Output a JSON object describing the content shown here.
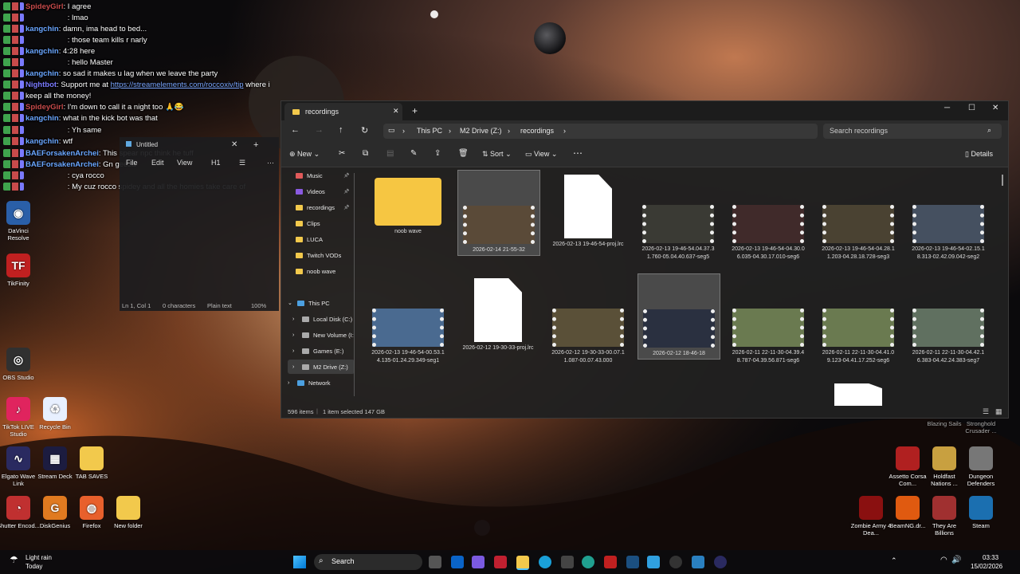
{
  "chat": [
    {
      "user": "SpideyGirl",
      "text": "I agree",
      "color": "#c84b4b"
    },
    {
      "user": "",
      "text": "lmao",
      "color": "#c84b4b"
    },
    {
      "user": "kangchin",
      "text": "damn, ima head to bed...",
      "color": "#6aa6ff"
    },
    {
      "user": "",
      "text": "those team kills r narly",
      "color": "#c84b4b"
    },
    {
      "user": "kangchin",
      "text": "4:28 here",
      "color": "#6aa6ff"
    },
    {
      "user": "",
      "text": "hello Master",
      "color": "#c84b4b"
    },
    {
      "user": "kangchin",
      "text": "so sad it makes u lag when we leave the party",
      "color": "#6aa6ff"
    },
    {
      "user": "Nightbot",
      "text": "Support me at",
      "link": "https://streamelements.com/roccoxiv/tip",
      "after": "where i",
      "color": "#7a7aff"
    },
    {
      "user": "",
      "text": "keep all the money!",
      "color": "#c84b4b"
    },
    {
      "user": "SpideyGirl",
      "text": "I'm down to call it a night too 🙏😂",
      "color": "#c84b4b"
    },
    {
      "user": "kangchin",
      "text": "what in the kick bot was that",
      "color": "#6aa6ff"
    },
    {
      "user": "",
      "text": "Yh same",
      "color": "#c84b4b"
    },
    {
      "user": "kangchin",
      "text": "wtf",
      "color": "#6aa6ff"
    },
    {
      "user": "BAEForsakenArchei",
      "text": "This spear npc think he tuff",
      "color": "#6aa6ff"
    },
    {
      "user": "BAEForsakenArchei",
      "text": "Gn geeza",
      "color": "#6aa6ff"
    },
    {
      "user": "",
      "text": "cya rocco",
      "color": "#c84b4b"
    },
    {
      "user": "",
      "text": "My cuz rocco spidey and all the homies take care of",
      "color": "#c84b4b"
    }
  ],
  "notepad": {
    "tab": "Untitled",
    "menu": [
      "File",
      "Edit",
      "View"
    ],
    "heading": "H1",
    "status": [
      "Ln 1, Col 1",
      "0 characters",
      "Plain text",
      "100%"
    ]
  },
  "desktop_left": [
    {
      "label": "DaVinci Resolve",
      "color": "#2a5fa8",
      "glyph": "◉"
    },
    {
      "label": "TikFinity",
      "color": "#c02020",
      "glyph": "TF"
    },
    {
      "label": "OBS Studio",
      "color": "#303030",
      "glyph": "◎"
    },
    {
      "label": "TikTok LIVE Studio",
      "color": "#e0245e",
      "glyph": "♪"
    },
    {
      "label": "Recycle Bin",
      "color": "#e8f0ff",
      "glyph": "♻"
    },
    {
      "label": "Elgato Wave Link",
      "color": "#2a2a60",
      "glyph": "∿"
    },
    {
      "label": "Stream Deck",
      "color": "#1c1c40",
      "glyph": "▦"
    },
    {
      "label": "TAB SAVES",
      "color": "#f2c94c",
      "glyph": ""
    },
    {
      "label": "Shutter Encod...",
      "color": "#c03030",
      "glyph": "◔"
    },
    {
      "label": "DiskGenius",
      "color": "#e07a20",
      "glyph": "G"
    },
    {
      "label": "Firefox",
      "color": "#e8602c",
      "glyph": "◍"
    },
    {
      "label": "New folder",
      "color": "#f2c94c",
      "glyph": ""
    }
  ],
  "desktop_right": [
    {
      "label": "Blazing Sails",
      "color": "#555"
    },
    {
      "label": "Stronghold Crusader ...",
      "color": "#555"
    },
    {
      "label": "Assetto Corsa Com...",
      "color": "#b02020"
    },
    {
      "label": "Holdfast Nations ...",
      "color": "#c8a040"
    },
    {
      "label": "Dungeon Defenders",
      "color": "#777"
    },
    {
      "label": "Zombie Army 4 Dea...",
      "color": "#8a1010"
    },
    {
      "label": "BeamNG.dr...",
      "color": "#e05a10"
    },
    {
      "label": "They Are Billions",
      "color": "#a03030"
    },
    {
      "label": "Steam",
      "color": "#1b6fb0"
    }
  ],
  "explorer": {
    "tab_title": "recordings",
    "breadcrumb": [
      "This PC",
      "M2 Drive (Z:)",
      "recordings"
    ],
    "search_placeholder": "Search recordings",
    "cmd": {
      "new": "New",
      "sort": "Sort",
      "view": "View",
      "details": "Details"
    },
    "quick_access": [
      "Music",
      "Videos",
      "recordings",
      "Clips",
      "LUCA",
      "Twitch VODs",
      "noob wave"
    ],
    "this_pc": "This PC",
    "drives": [
      "Local Disk (C:)",
      "New Volume (I:",
      "Games (E:)",
      "M2 Drive (Z:)"
    ],
    "network": "Network",
    "status": {
      "items": "596 items",
      "selected": "1 item selected  147 GB"
    },
    "files": [
      {
        "type": "folder",
        "name": "noob wave"
      },
      {
        "type": "video",
        "name": "2026-02-14 21-55-32",
        "selected": true,
        "tint": "#5a4a38"
      },
      {
        "type": "doc",
        "name": "2026-02-13 19-46-54-proj.lrc"
      },
      {
        "type": "video",
        "name": "2026-02-13 19-46-54.04.37.31.760-05.04.40.637-seg5",
        "tint": "#3a3a34"
      },
      {
        "type": "video",
        "name": "2026-02-13 19-46-54-04.30.06.035-04.30.17.010-seg6",
        "tint": "#402a2a"
      },
      {
        "type": "video",
        "name": "2026-02-13 19-46-54-04.28.11.203-04.28.18.728-seg3",
        "tint": "#4a4232"
      },
      {
        "type": "video",
        "name": "2026-02-13 19-46-54-02.15.18.313-02.42.09.042-seg2",
        "tint": "#455060"
      },
      {
        "type": "video",
        "name": "2026-02-13 19-46-54-00.53.14.135-01.24.29.349-seg1",
        "tint": "#4a6a90"
      },
      {
        "type": "doc",
        "name": "2026-02-12 19-30-33-proj.lrc"
      },
      {
        "type": "video",
        "name": "2026-02-12 19-30-33-00.07.11.087-00.07.43.000",
        "tint": "#5a5038"
      },
      {
        "type": "video",
        "name": "2026-02-12 18-46-18",
        "selected": true,
        "tint": "#2a3040"
      },
      {
        "type": "video",
        "name": "2026-02-11 22-11-30-04.39.48.787-04.39.56.871-seg6",
        "tint": "#6a7a50"
      },
      {
        "type": "video",
        "name": "2026-02-11 22-11-30-04.41.09.123-04.41.17.252-seg6",
        "tint": "#6a7a50"
      },
      {
        "type": "video",
        "name": "2026-02-11 22-11-30-04.42.16.383-04.42.24.383-seg7",
        "tint": "#607060"
      }
    ]
  },
  "taskbar": {
    "weather_temp": "Light rain",
    "weather_day": "Today",
    "search": "Search",
    "time": "03:33",
    "date": "15/02/2026"
  }
}
